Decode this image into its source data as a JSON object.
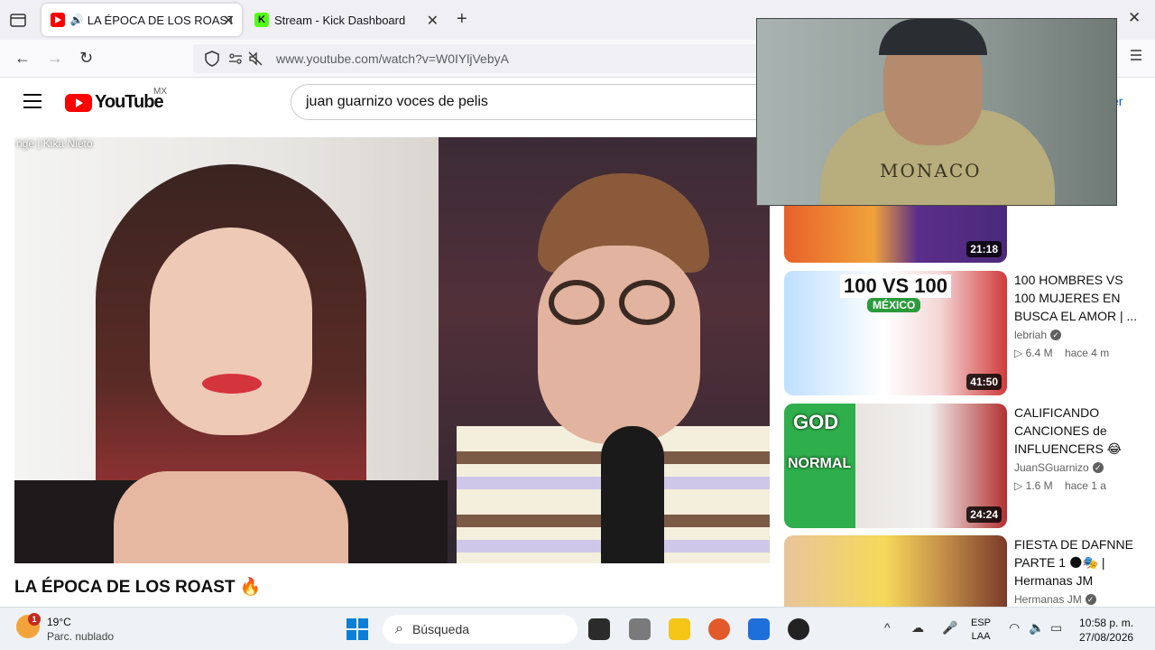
{
  "browser": {
    "tabs": [
      {
        "label": "LA ÉPOCA DE LOS ROAST",
        "active": true
      },
      {
        "label": "Stream - Kick Dashboard",
        "active": false
      }
    ],
    "url_display": "www.youtube.com/watch?v=W0IYljVebyA"
  },
  "youtube": {
    "logo_text": "YouTube",
    "country_code": "MX",
    "search_value": "juan guarnizo voces de pelis",
    "signin_fragment": "er"
  },
  "player": {
    "overlay_text": "nge | Kika Nieto",
    "title": "LA ÉPOCA DE LOS ROAST 🔥"
  },
  "webcam": {
    "hoodie_text": "MONACO"
  },
  "recommendations": [
    {
      "duration": "21:18"
    },
    {
      "thumb_text": "100 VS 100",
      "thumb_sub": "MÉXICO",
      "title": "100 HOMBRES VS 100 MUJERES EN BUSCA EL AMOR | ...",
      "channel": "lebriah",
      "views": "6.4 M",
      "age": "hace 4 m",
      "duration": "41:50"
    },
    {
      "thumb_text": "GOD",
      "thumb_sub": "NORMAL",
      "title": "CALIFICANDO CANCIONES de INFLUENCERS 😂",
      "channel": "JuanSGuarnizo",
      "views": "1.6 M",
      "age": "hace 1 a",
      "duration": "24:24"
    },
    {
      "title": "FIESTA DE DAFNNE PARTE 1 🌑🎭 | Hermanas JM",
      "channel": "Hermanas JM"
    }
  ],
  "taskbar": {
    "weather_badge": "1",
    "temperature": "19°C",
    "condition": "Parc. nublado",
    "search_placeholder": "Búsqueda",
    "lang_line1": "ESP",
    "lang_line2": "LAA",
    "time": "10:58 p. m.",
    "date": "27/08/2026"
  },
  "colors": {
    "yt_red": "#ff0000",
    "link_blue": "#065fd4",
    "kick_green": "#53fc18"
  }
}
